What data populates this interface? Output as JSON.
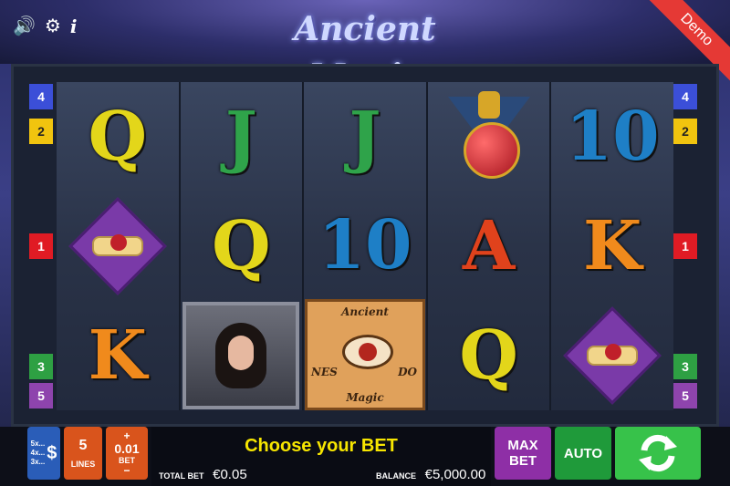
{
  "header": {
    "logo_text": "Ancient Magic",
    "demo_label": "Demo",
    "icons": [
      "sound-icon",
      "gear-icon",
      "info-icon"
    ]
  },
  "lines": {
    "left": [
      "4",
      "2",
      "1",
      "3",
      "5"
    ],
    "right": [
      "4",
      "2",
      "1",
      "3",
      "5"
    ],
    "colors": {
      "1": "#e01b24",
      "2": "#f1c40f",
      "3": "#2ea043",
      "4": "#3b4fd8",
      "5": "#8e44ad"
    }
  },
  "reels": [
    [
      "Q",
      "scroll",
      "K"
    ],
    [
      "J",
      "Q",
      "sorceress"
    ],
    [
      "J",
      "10",
      "book"
    ],
    [
      "potion",
      "A",
      "Q"
    ],
    [
      "10",
      "K",
      "scroll"
    ]
  ],
  "symbol_colors": {
    "Q": "#e3d61a",
    "J": "#2fa34a",
    "10": "#1e7fc6",
    "K": "#f08a1c",
    "A": "#e0421c"
  },
  "book_text": {
    "top": "Ancient",
    "bottom": "Magic",
    "left": "NES",
    "right": "DO"
  },
  "controls": {
    "coin_labels": [
      "5x...",
      "4x...",
      "3x..."
    ],
    "lines_value": "5",
    "lines_label": "LINES",
    "bet_value": "0.01",
    "bet_label": "BET",
    "plus": "+",
    "minus": "−",
    "message": "Choose your BET",
    "total_bet_label": "TOTAL BET",
    "total_bet_value": "€0.05",
    "balance_label": "BALANCE",
    "balance_value": "€5,000.00",
    "max_bet_line1": "MAX",
    "max_bet_line2": "BET",
    "auto_label": "AUTO"
  }
}
